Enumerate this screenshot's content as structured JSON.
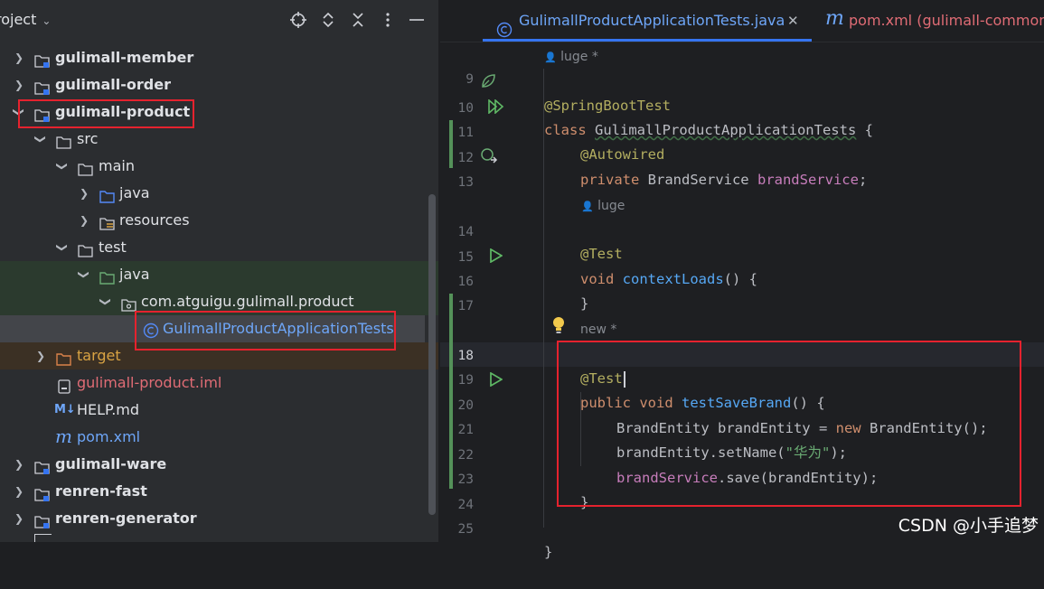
{
  "project_panel": {
    "title": "roject",
    "header_icons": [
      "locate-icon",
      "expand-collapse-icon",
      "collapse-all-icon",
      "more-options-icon",
      "minimize-icon"
    ],
    "tree": [
      {
        "label": "gulimall-member",
        "kind": "module",
        "expanded": false
      },
      {
        "label": "gulimall-order",
        "kind": "module",
        "expanded": false
      },
      {
        "label": "gulimall-product",
        "kind": "module",
        "expanded": true
      },
      {
        "label": "src",
        "kind": "folder",
        "expanded": true
      },
      {
        "label": "main",
        "kind": "folder",
        "expanded": true
      },
      {
        "label": "java",
        "kind": "source-folder",
        "expanded": false
      },
      {
        "label": "resources",
        "kind": "resources-folder",
        "expanded": false
      },
      {
        "label": "test",
        "kind": "folder",
        "expanded": true
      },
      {
        "label": "java",
        "kind": "test-folder",
        "expanded": true
      },
      {
        "label": "com.atguigu.gulimall.product",
        "kind": "package",
        "expanded": true
      },
      {
        "label": "GulimallProductApplicationTests",
        "kind": "class",
        "selected": true
      },
      {
        "label": "target",
        "kind": "excluded-folder",
        "expanded": false
      },
      {
        "label": "gulimall-product.iml",
        "kind": "iml-file"
      },
      {
        "label": "HELP.md",
        "kind": "markdown-file"
      },
      {
        "label": "pom.xml",
        "kind": "maven-file"
      },
      {
        "label": "gulimall-ware",
        "kind": "module",
        "expanded": false
      },
      {
        "label": "renren-fast",
        "kind": "module",
        "expanded": false
      },
      {
        "label": "renren-generator",
        "kind": "module",
        "expanded": false
      }
    ]
  },
  "tabs": [
    {
      "label": "GulimallProductApplicationTests.java",
      "active": true,
      "closable": true,
      "icon": "class-icon"
    },
    {
      "label": "pom.xml (gulimall-common)",
      "active": false,
      "icon": "maven-icon"
    }
  ],
  "editor": {
    "author_hints": [
      "luge *",
      "luge",
      "new *"
    ],
    "line_numbers": [
      "9",
      "10",
      "11",
      "12",
      "13",
      "14",
      "15",
      "16",
      "17",
      "18",
      "19",
      "20",
      "21",
      "22",
      "23",
      "24",
      "25"
    ],
    "current_line": "18",
    "code": {
      "l9": "@SpringBootTest",
      "l10_kw": "class",
      "l10_name": "GulimallProductApplicationTests",
      "l10_rest": " {",
      "l11": "@Autowired",
      "l12_kw": "private",
      "l12_type": " BrandService ",
      "l12_field": "brandService",
      "l12_end": ";",
      "l14": "@Test",
      "l15_kw": "void",
      "l15_method": "contextLoads",
      "l15_rest": "() {",
      "l16": "}",
      "l18": "@Test",
      "l19_kw1": "public",
      "l19_kw2": "void",
      "l19_method": "testSaveBrand",
      "l19_rest": "() {",
      "l20_a": "BrandEntity brandEntity = ",
      "l20_kw": "new",
      "l20_b": " BrandEntity();",
      "l21_a": "brandEntity.setName(",
      "l21_str": "\"华为\"",
      "l21_b": ");",
      "l22_field": "brandService",
      "l22_rest": ".save(brandEntity);",
      "l23": "}",
      "l25": "}"
    }
  },
  "watermark": "CSDN @小手追梦",
  "colors": {
    "highlight_box": "#e5222e",
    "accent": "#3574f0",
    "keyword": "#cf8e6d",
    "annotation": "#b3ae60",
    "field": "#c77dbb",
    "method": "#56a8f5",
    "string": "#6aab73"
  }
}
